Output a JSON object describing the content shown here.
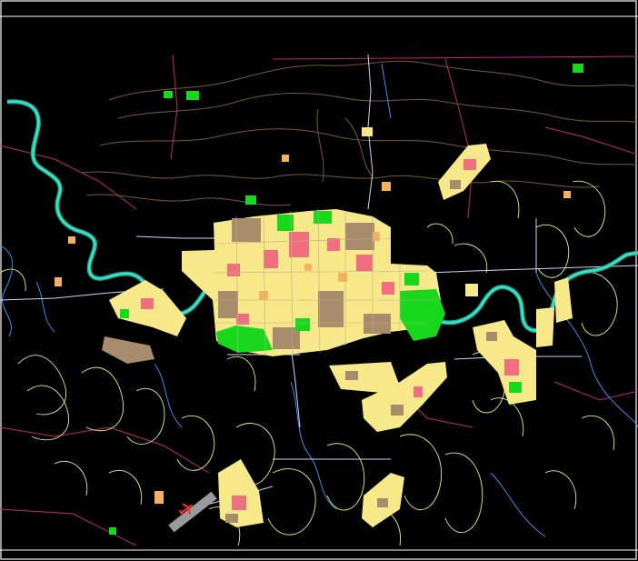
{
  "map": {
    "background": "#000000",
    "frame_color": "#ffffff",
    "colors": {
      "river": "#3ee0c8",
      "river_dark": "#1aa88c",
      "park": "#17d81b",
      "residential": "#f7e88a",
      "commercial": "#ef6f7e",
      "industrial": "#a78b6a",
      "public": "#f5b25e",
      "contour": "#e6f27a",
      "brown_contour": "#7a5a30",
      "boundary": "#c0287a",
      "roads": "#cfd6ff",
      "stream": "#3aa0ff",
      "airport_runway": "#9a9a9a",
      "airport_symbol": "#ff2a2a"
    },
    "symbols": [
      "airport-icon"
    ]
  }
}
